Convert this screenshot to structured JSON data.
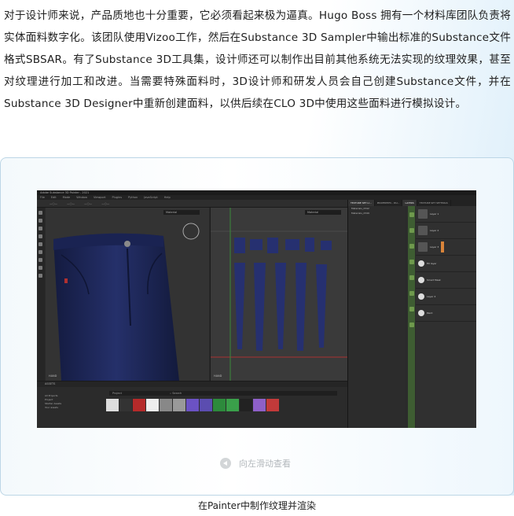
{
  "article": {
    "paragraph": "对于设计师来说，产品质地也十分重要，它必须看起来极为逼真。Hugo Boss 拥有一个材料库团队负责将实体面料数字化。该团队使用Vizoo工作，然后在Substance 3D Sampler中输出标准的Substance文件格式SBSAR。有了Substance 3D工具集，设计师还可以制作出目前其他系统无法实现的纹理效果，甚至对纹理进行加工和改进。当需要特殊面料时，3D设计师和研发人员会自己创建Substance文件，并在Substance 3D Designer中重新创建面料，以供后续在CLO 3D中使用这些面料进行模拟设计。"
  },
  "figure": {
    "swipe_hint": "向左滑动查看",
    "caption": "在Painter中制作纹理并渲染"
  },
  "painter": {
    "window_title": "Adobe Substance 3D Painter - 2021",
    "menu": [
      "File",
      "Edit",
      "Mode",
      "Window",
      "Viewport",
      "Plugins",
      "Python",
      "JavaScript",
      "Help"
    ],
    "viewport_3d_select": "Material",
    "viewport_2d_select": "Material",
    "viewport_3d_label": "HAND",
    "viewport_2d_label": "HAND",
    "panel_tabs": [
      "TEXTURE SET LI...",
      "PROPERTIES - PAI...",
      "LAYERS",
      "TEXTURE SET SETTINGS"
    ],
    "texture_sets": [
      "Materials_2342",
      "Materials_2349"
    ],
    "assets_title": "ASSETS",
    "assets_filter": "Project",
    "assets_search": "Search",
    "assets_side_items": [
      "All Projects",
      "Project",
      "Starter Assets",
      "Your assets"
    ],
    "layers": [
      "Layer 1",
      "Layer 2",
      "Layer 3",
      "Fill layer",
      "Smart Mask",
      "Layer 4",
      "Paint"
    ]
  },
  "colors": {
    "denim": "#1c2656",
    "accent_orange": "#d9843a",
    "layers_green": "#3e5d32"
  }
}
